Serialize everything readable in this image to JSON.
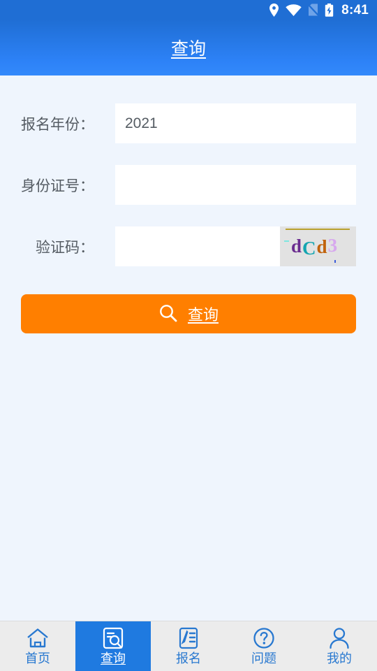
{
  "status_bar": {
    "time": "8:41",
    "icons": [
      "location-pin-icon",
      "wifi-icon",
      "no-sim-icon",
      "battery-charging-icon"
    ]
  },
  "header": {
    "title": "查询"
  },
  "form": {
    "fields": [
      {
        "label": "报名年份：",
        "value": "2021",
        "placeholder": ""
      },
      {
        "label": "身份证号：",
        "value": "",
        "placeholder": ""
      },
      {
        "label": "验证码：",
        "value": "",
        "placeholder": ""
      }
    ],
    "captcha": {
      "text": "dCd3",
      "chars": [
        "d",
        "C",
        "d",
        "3"
      ],
      "colors": [
        "#6a2c8f",
        "#14a5b0",
        "#c1620c",
        "#d7a8ee"
      ],
      "background": "#e2e2e2"
    },
    "submit": {
      "label": "查询",
      "icon": "search-icon",
      "color": "#ff7f00"
    }
  },
  "tab_bar": {
    "active_index": 1,
    "items": [
      {
        "label": "首页",
        "icon": "home-icon"
      },
      {
        "label": "查询",
        "icon": "document-search-icon"
      },
      {
        "label": "报名",
        "icon": "document-pen-icon"
      },
      {
        "label": "问题",
        "icon": "question-circle-icon"
      },
      {
        "label": "我的",
        "icon": "person-icon"
      }
    ]
  },
  "colors": {
    "brand_blue": "#1f7ae0",
    "header_gradient_top": "#1f6ed4",
    "header_gradient_bottom": "#3389fb",
    "page_background": "#eff5fd",
    "accent_orange": "#ff7f00",
    "tab_bar_background": "#ececec",
    "label_text": "#555c63"
  }
}
